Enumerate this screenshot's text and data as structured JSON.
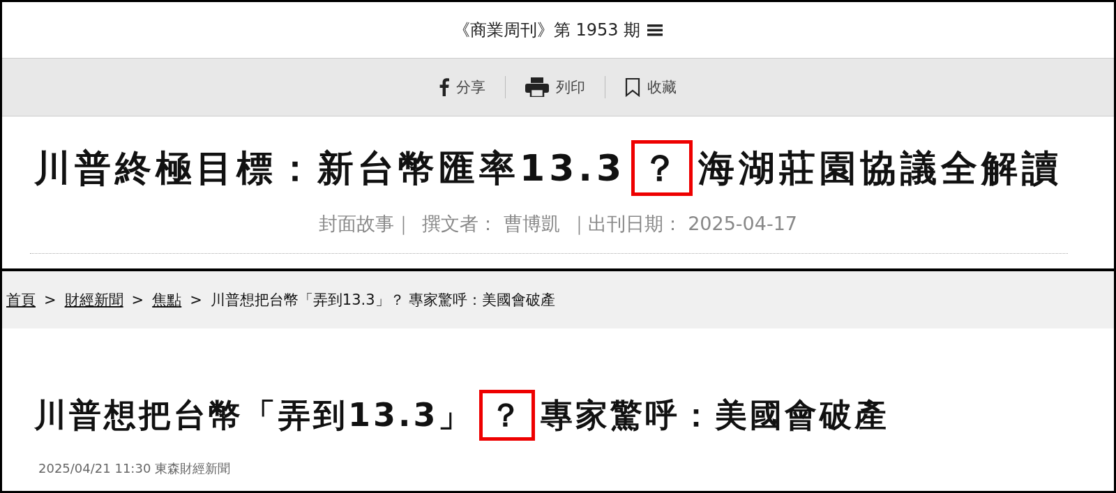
{
  "top_panel": {
    "issue_title": "《商業周刊》第 1953 期",
    "actions": [
      {
        "kind": "facebook",
        "label": "分享"
      },
      {
        "kind": "print",
        "label": "列印"
      },
      {
        "kind": "bookmark",
        "label": "收藏"
      }
    ],
    "headline": [
      {
        "text": "川普終極目標：新台幣匯率13.3",
        "highlighted": false
      },
      {
        "text": "？",
        "highlighted": true
      },
      {
        "text": "海湖莊園協議全解讀",
        "highlighted": false
      }
    ],
    "meta": [
      "封面故事｜",
      "撰文者： 曹博凱",
      "｜出刊日期： 2025-04-17"
    ]
  },
  "bottom_panel": {
    "breadcrumbs": [
      {
        "text": "首頁",
        "link": true
      },
      {
        "text": ">",
        "link": false
      },
      {
        "text": "財經新聞",
        "link": true
      },
      {
        "text": ">",
        "link": false
      },
      {
        "text": "焦點",
        "link": true
      },
      {
        "text": ">",
        "link": false
      },
      {
        "text": "川普想把台幣「弄到13.3」？ 專家驚呼：美國會破產",
        "link": false
      }
    ],
    "headline": [
      {
        "text": "川普想把台幣「弄到13.3」",
        "highlighted": false
      },
      {
        "text": "？",
        "highlighted": true
      },
      {
        "text": "專家驚呼：美國會破產",
        "highlighted": false
      }
    ],
    "byline": "2025/04/21 11:30 東森財經新聞"
  }
}
